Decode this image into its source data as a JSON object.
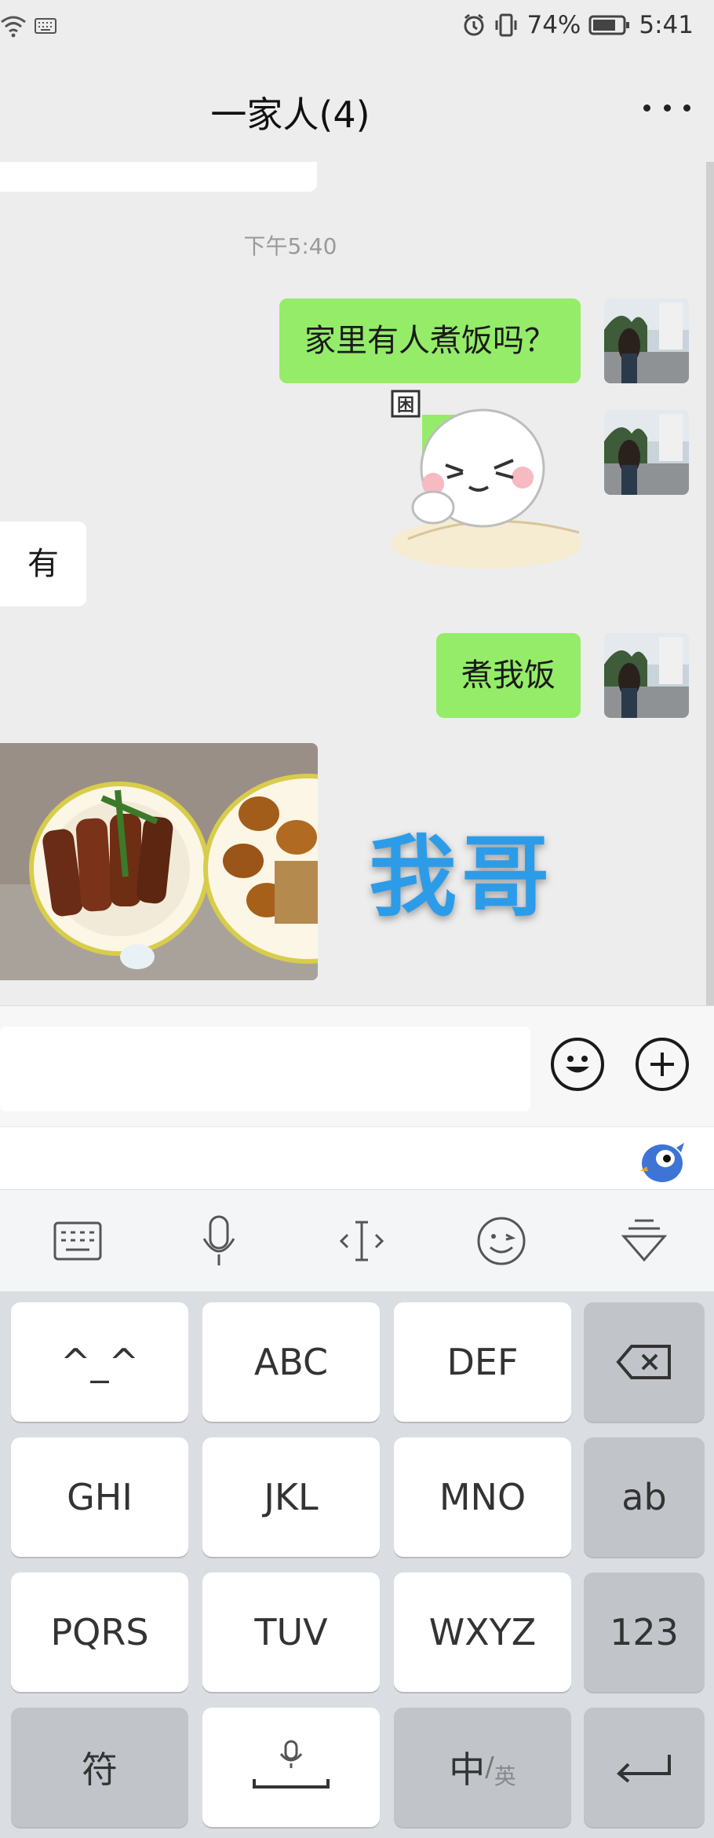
{
  "status_bar": {
    "battery_percent": "74%",
    "time": "5:41",
    "icons": [
      "wifi-icon",
      "keyboard-icon",
      "alarm-icon",
      "vibrate-icon",
      "battery-icon"
    ]
  },
  "header": {
    "title": "一家人(4)",
    "more_icon": "more-icon"
  },
  "chat": {
    "timestamp": "下午5:40",
    "messages": [
      {
        "side": "right",
        "type": "text",
        "text": "家里有人煮饭吗？"
      },
      {
        "side": "right",
        "type": "sticker",
        "text": "困"
      },
      {
        "side": "left",
        "type": "text",
        "text": "有"
      },
      {
        "side": "right",
        "type": "text",
        "text": "煮我饭"
      },
      {
        "side": "left",
        "type": "image",
        "overlay": "我哥"
      }
    ]
  },
  "input_bar": {
    "placeholder": "",
    "icons": [
      "emoji-icon",
      "plus-icon"
    ]
  },
  "keyboard_toolbar": {
    "icons": [
      "keyboard-icon",
      "microphone-icon",
      "cursor-icon",
      "smiley-icon",
      "collapse-icon"
    ]
  },
  "keyboard": {
    "rows": [
      [
        "^_^",
        "ABC",
        "DEF",
        "⌫"
      ],
      [
        "GHI",
        "JKL",
        "MNO",
        "ab"
      ],
      [
        "PQRS",
        "TUV",
        "WXYZ",
        "123"
      ],
      [
        "符",
        "␣",
        "中/英",
        "↵"
      ]
    ],
    "labels": {
      "r1k1": "^_^",
      "r1k2": "ABC",
      "r1k3": "DEF",
      "r2k1": "GHI",
      "r2k2": "JKL",
      "r2k3": "MNO",
      "r2k4": "ab",
      "r3k1": "PQRS",
      "r3k2": "TUV",
      "r3k3": "WXYZ",
      "r3k4": "123",
      "r4k1": "符",
      "r4k3_main": "中",
      "r4k3_sub": "英"
    }
  },
  "colors": {
    "background": "#ededed",
    "bubble_green": "#95ec69",
    "bubble_white": "#ffffff",
    "overlay_blue": "#2d9ce8",
    "keyboard_bg": "#dadde1"
  }
}
